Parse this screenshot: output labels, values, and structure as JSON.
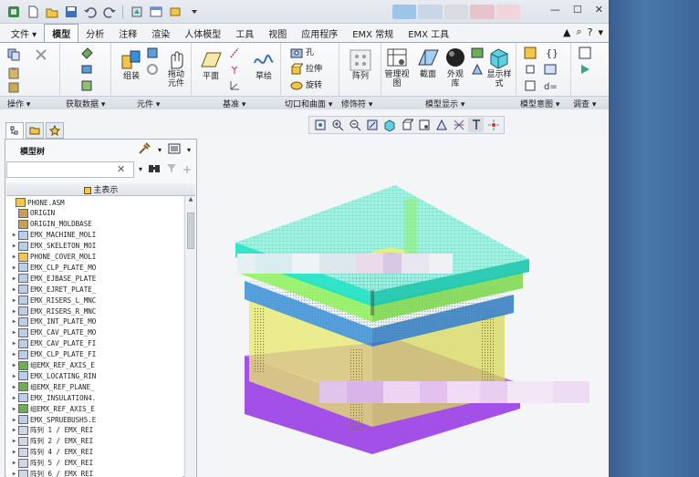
{
  "menu": {
    "tabs": [
      "文件 ▾",
      "模型",
      "分析",
      "注释",
      "渲染",
      "人体模型",
      "工具",
      "视图",
      "应用程序",
      "EMX 常规",
      "EMX 工具"
    ],
    "active_tab": "模型"
  },
  "ribbon": {
    "buttons": {
      "assemble": "组装",
      "drag_components": "拖动\n元件",
      "plane": "平面",
      "sketch": "草绘",
      "hole": "孔",
      "extrude": "拉伸",
      "revolve": "旋转",
      "pattern": "阵列",
      "manage_views": "管理视\n图",
      "section": "截面",
      "appearance_library": "外观\n库",
      "display_style": "显示样\n式"
    },
    "groups": [
      "操作 ▾",
      "获取数据 ▾",
      "元件 ▾",
      "基准 ▾",
      "切口和曲面 ▾",
      "修饰符 ▾",
      "模型显示 ▾",
      "模型意图 ▾",
      "调查 ▾"
    ]
  },
  "model_tree": {
    "title": "模型树",
    "header": "主表示",
    "items": [
      {
        "label": "PHONE.ASM",
        "icon": "assembly",
        "expand": false,
        "indent": 0
      },
      {
        "label": "ORIGIN",
        "icon": "csys",
        "expand": false,
        "indent": 1
      },
      {
        "label": "ORIGIN_MOLDBASE",
        "icon": "csys",
        "expand": false,
        "indent": 1
      },
      {
        "label": "EMX_MACHINE_MOLI",
        "icon": "part",
        "expand": true,
        "indent": 1
      },
      {
        "label": "EMX_SKELETON_MOI",
        "icon": "part",
        "expand": true,
        "indent": 1
      },
      {
        "label": "PHONE_COVER_MOLI",
        "icon": "asm",
        "expand": true,
        "indent": 1
      },
      {
        "label": "EMX_CLP_PLATE_MO",
        "icon": "part",
        "expand": true,
        "indent": 1
      },
      {
        "label": "EMX_EJBASE_PLATE",
        "icon": "part",
        "expand": true,
        "indent": 1
      },
      {
        "label": "EMX_EJRET_PLATE_",
        "icon": "part",
        "expand": true,
        "indent": 1
      },
      {
        "label": "EMX_RISERS_L_MNC",
        "icon": "part",
        "expand": true,
        "indent": 1
      },
      {
        "label": "EMX_RISERS_R_MNC",
        "icon": "part",
        "expand": true,
        "indent": 1
      },
      {
        "label": "EMX_INT_PLATE_MO",
        "icon": "part",
        "expand": true,
        "indent": 1
      },
      {
        "label": "EMX_CAV_PLATE_MO",
        "icon": "part",
        "expand": true,
        "indent": 1
      },
      {
        "label": "EMX_CAV_PLATE_FI",
        "icon": "part",
        "expand": true,
        "indent": 1
      },
      {
        "label": "EMX_CLP_PLATE_FI",
        "icon": "part",
        "expand": true,
        "indent": 1
      },
      {
        "label": "组EMX_REF_AXIS_E",
        "icon": "group",
        "expand": true,
        "indent": 1
      },
      {
        "label": "EMX_LOCATING_RIN",
        "icon": "part",
        "expand": true,
        "indent": 1
      },
      {
        "label": "组EMX_REF_PLANE_",
        "icon": "group",
        "expand": true,
        "indent": 1
      },
      {
        "label": "EMX_INSULATION4.",
        "icon": "part",
        "expand": true,
        "indent": 1
      },
      {
        "label": "组EMX_REF_AXIS_E",
        "icon": "group",
        "expand": true,
        "indent": 1
      },
      {
        "label": "EMX_SPRUEBUSH5.E",
        "icon": "part",
        "expand": true,
        "indent": 1
      },
      {
        "label": "阵列 1 / EMX_REI",
        "icon": "pattern",
        "expand": true,
        "indent": 1
      },
      {
        "label": "阵列 2 / EMX_REI",
        "icon": "pattern",
        "expand": true,
        "indent": 1
      },
      {
        "label": "阵列 4 / EMX_REI",
        "icon": "pattern",
        "expand": true,
        "indent": 1
      },
      {
        "label": "阵列 5 / EMX_REI",
        "icon": "pattern",
        "expand": true,
        "indent": 1
      },
      {
        "label": "阵列 6 / EMX_REI",
        "icon": "pattern",
        "expand": true,
        "indent": 1
      }
    ]
  },
  "colors": {
    "plate_top": "#1ee3c4",
    "plate_green": "#8ff25b",
    "plate_blue": "#3a8fd8",
    "plate_yellow": "#e8e86a",
    "plate_purple": "#9a3ee6",
    "tree_bg": "#ffffff",
    "accent": "#3a6fbf"
  }
}
